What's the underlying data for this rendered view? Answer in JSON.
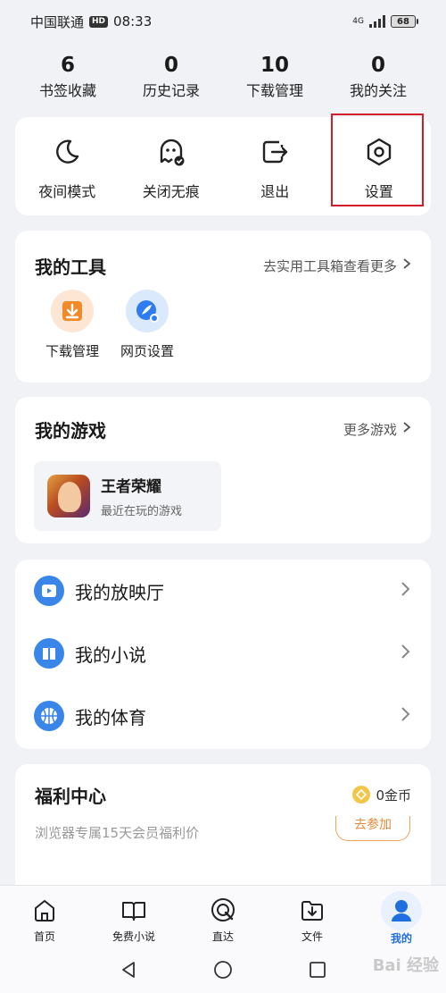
{
  "status_bar": {
    "carrier": "中国联通",
    "hd": "HD",
    "time": "08:33",
    "network": "4G",
    "battery": "68"
  },
  "stats": [
    {
      "num": "6",
      "label": "书签收藏"
    },
    {
      "num": "0",
      "label": "历史记录"
    },
    {
      "num": "10",
      "label": "下载管理"
    },
    {
      "num": "0",
      "label": "我的关注"
    }
  ],
  "quick_actions": [
    {
      "label": "夜间模式",
      "icon": "moon-icon"
    },
    {
      "label": "关闭无痕",
      "icon": "ghost-icon"
    },
    {
      "label": "退出",
      "icon": "exit-icon"
    },
    {
      "label": "设置",
      "icon": "settings-icon"
    }
  ],
  "tools": {
    "title": "我的工具",
    "more": "去实用工具箱查看更多",
    "items": [
      {
        "label": "下载管理",
        "icon": "download-icon",
        "color": "#f28a2a"
      },
      {
        "label": "网页设置",
        "icon": "web-settings-icon",
        "color": "#2f7cf0"
      }
    ]
  },
  "games": {
    "title": "我的游戏",
    "more": "更多游戏",
    "item": {
      "name": "王者荣耀",
      "sub": "最近在玩的游戏"
    }
  },
  "media": [
    {
      "label": "我的放映厅",
      "icon": "play-icon"
    },
    {
      "label": "我的小说",
      "icon": "book-icon"
    },
    {
      "label": "我的体育",
      "icon": "basketball-icon"
    }
  ],
  "welfare": {
    "title": "福利中心",
    "coins": "0金币",
    "sub": "浏览器专属15天会员福利价",
    "join": "去参加"
  },
  "bottom_nav": [
    {
      "label": "首页",
      "icon": "home-icon"
    },
    {
      "label": "免费小说",
      "icon": "open-book-icon"
    },
    {
      "label": "直达",
      "icon": "direct-icon"
    },
    {
      "label": "文件",
      "icon": "folder-icon"
    },
    {
      "label": "我的",
      "icon": "profile-icon"
    }
  ],
  "watermark": "Bai 经验",
  "colors": {
    "accent": "#2f7cf0",
    "highlight": "#d41b2c",
    "orange": "#f28a2a"
  }
}
